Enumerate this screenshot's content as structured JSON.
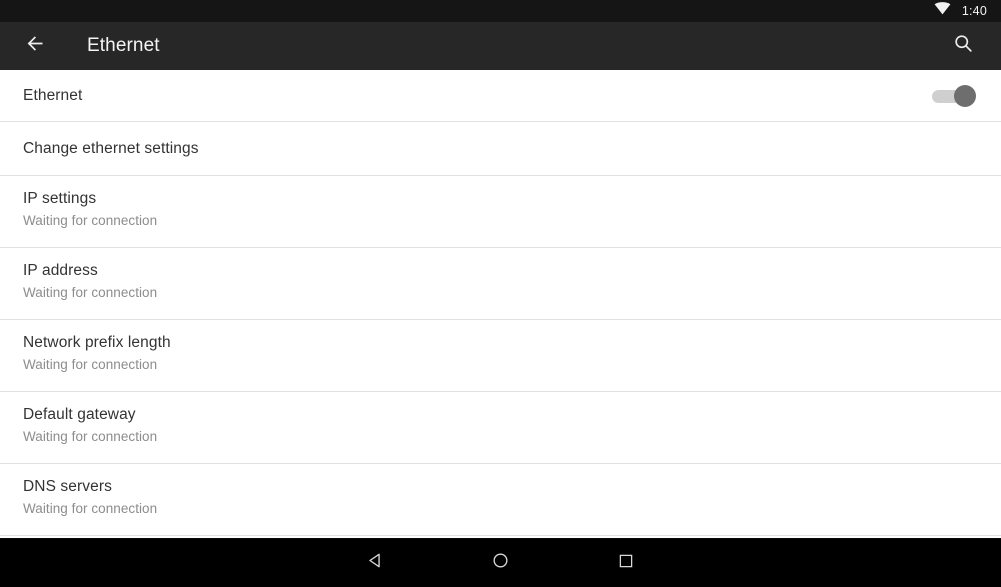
{
  "status_bar": {
    "wifi_icon": "wifi-signal-icon",
    "time": "1:40",
    "background_color": "#151515",
    "text_color": "#f2f2f2"
  },
  "app_bar": {
    "back_icon": "back-arrow-icon",
    "title": "Ethernet",
    "search_icon": "search-icon",
    "background_color": "#272727",
    "title_color": "#f5f5f5"
  },
  "list": {
    "rows": [
      {
        "type": "toggle",
        "title": "Ethernet",
        "summary": "",
        "toggle_state": "on",
        "toggle_enabled": "false",
        "track_color": "#cfcfcf",
        "thumb_color": "#6e6e6e"
      },
      {
        "type": "single",
        "title": "Change ethernet settings",
        "summary": ""
      },
      {
        "type": "two-line",
        "title": "IP settings",
        "summary": "Waiting for connection"
      },
      {
        "type": "two-line",
        "title": "IP address",
        "summary": "Waiting for connection"
      },
      {
        "type": "two-line",
        "title": "Network prefix length",
        "summary": "Waiting for connection"
      },
      {
        "type": "two-line",
        "title": "Default gateway",
        "summary": "Waiting for connection"
      },
      {
        "type": "two-line",
        "title": "DNS servers",
        "summary": "Waiting for connection"
      }
    ],
    "title_color": "#333333",
    "summary_color": "#8c8c8c",
    "divider_color": "#e2e2e2",
    "background_color": "#ffffff"
  },
  "nav_bar": {
    "background_color": "#000000",
    "buttons": [
      {
        "name": "back",
        "icon": "nav-back-triangle-icon"
      },
      {
        "name": "home",
        "icon": "nav-home-circle-icon"
      },
      {
        "name": "recents",
        "icon": "nav-recents-square-icon"
      }
    ]
  }
}
